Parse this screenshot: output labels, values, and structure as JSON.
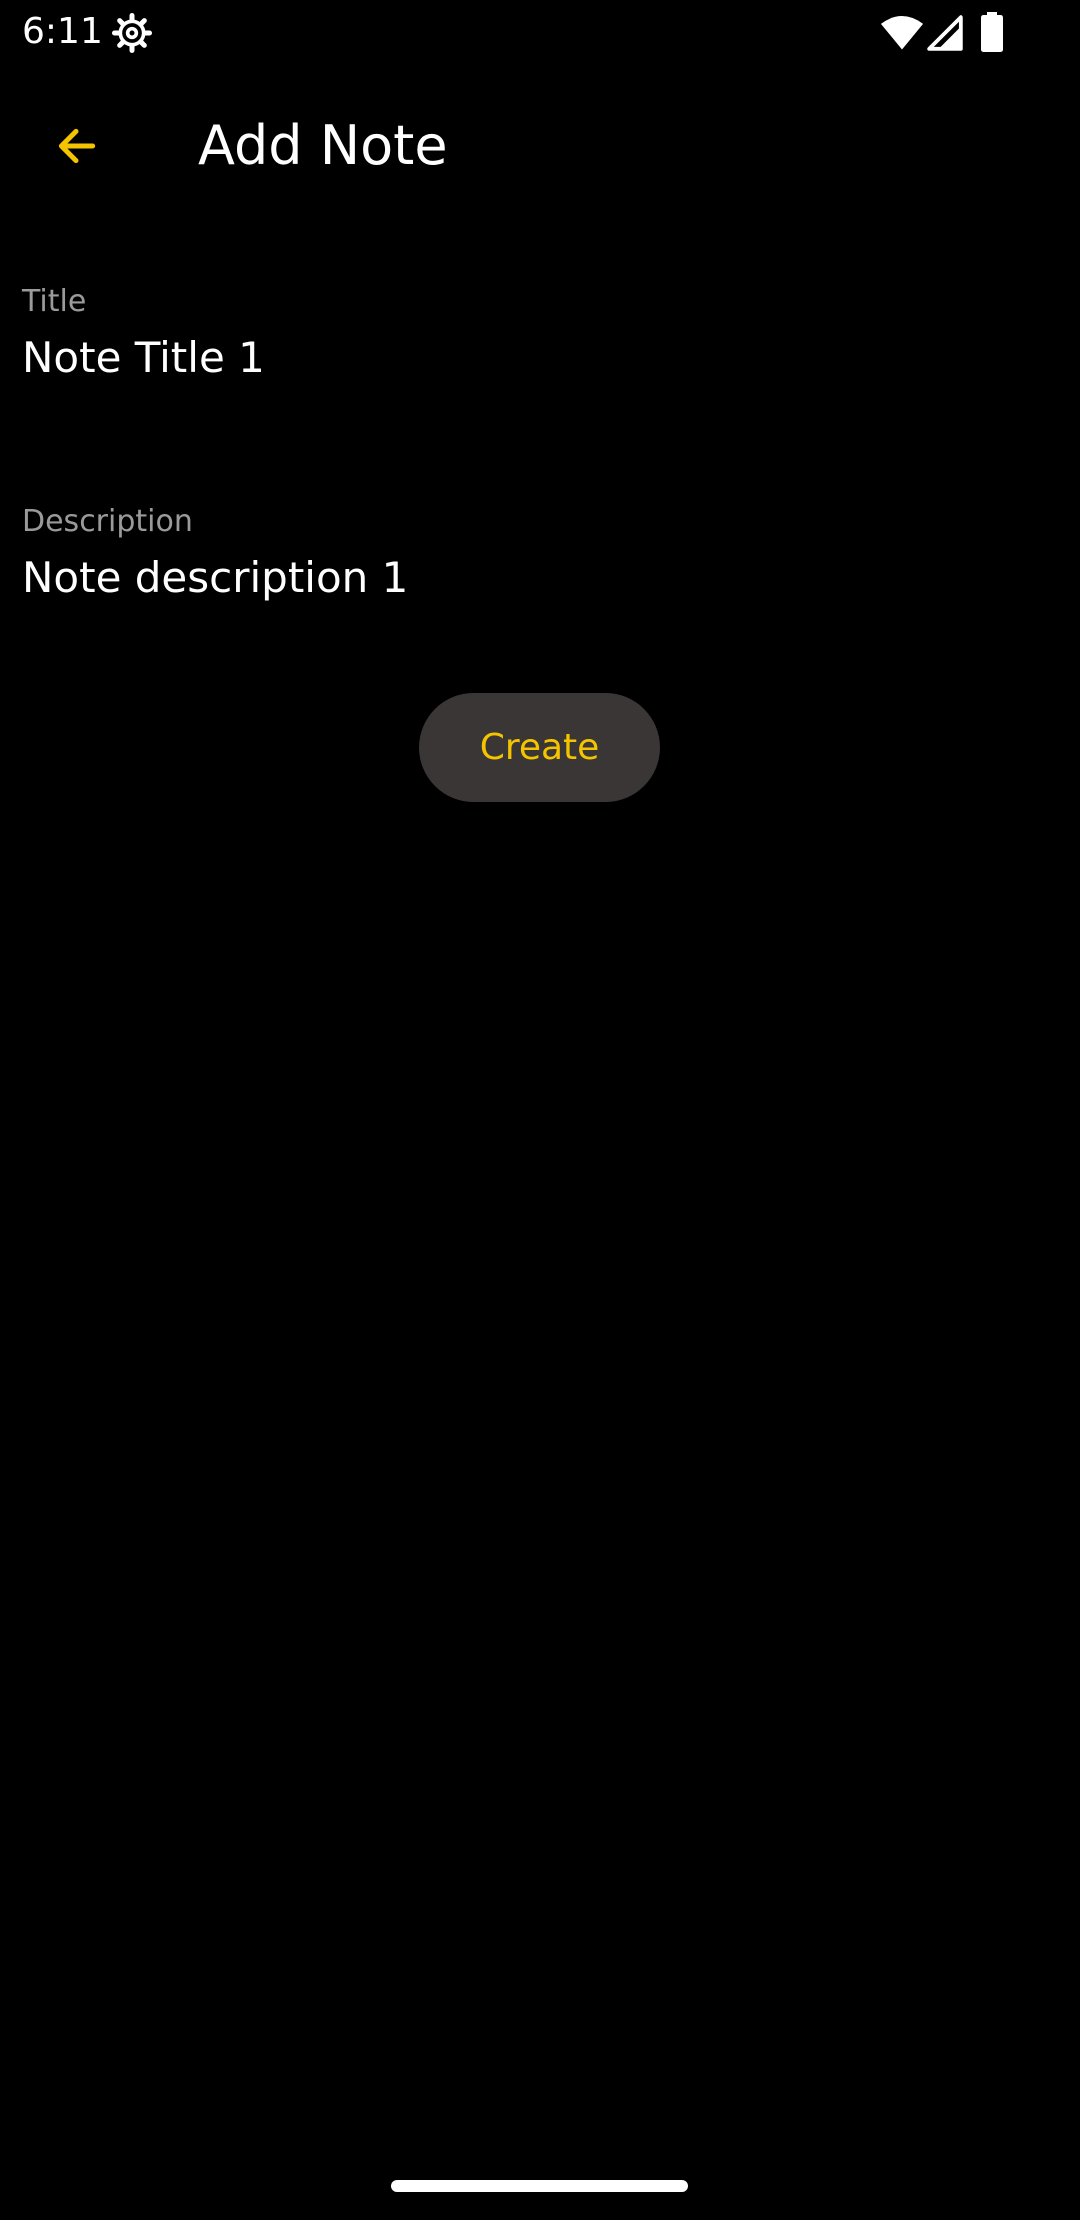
{
  "status_bar": {
    "time": "6:11",
    "icons": [
      "gear-icon",
      "wifi-icon",
      "cell-signal-icon",
      "battery-icon"
    ]
  },
  "app_bar": {
    "back_icon": "arrow-back-icon",
    "title": "Add Note"
  },
  "form": {
    "title_field": {
      "label": "Title",
      "value": "Note Title 1"
    },
    "description_field": {
      "label": "Description",
      "value": "Note description 1"
    },
    "create_label": "Create"
  },
  "colors": {
    "background": "#000000",
    "accent": "#f5c400",
    "button_bg": "#3a3635",
    "label_gray": "#9a9a9a",
    "text": "#ffffff"
  }
}
